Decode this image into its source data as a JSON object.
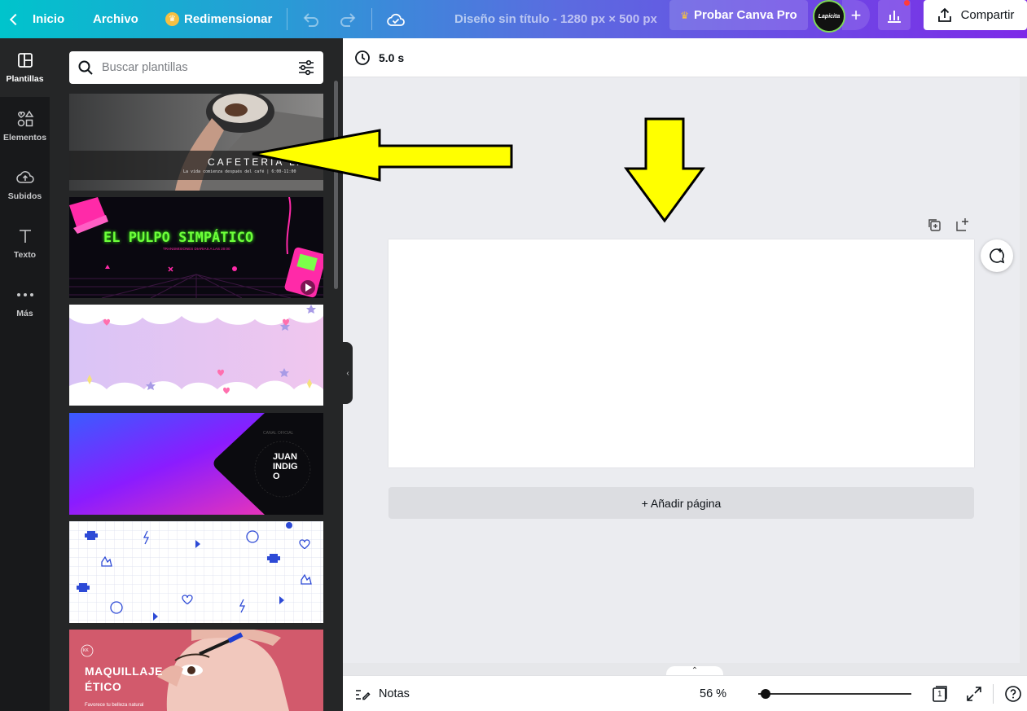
{
  "topbar": {
    "back_label": "Inicio",
    "file_label": "Archivo",
    "resize_label": "Redimensionar",
    "design_title": "Diseño sin título - 1280 px × 500 px",
    "pro_label": "Probar Canva Pro",
    "share_label": "Compartir",
    "avatar_text": "Lapicita"
  },
  "rail": {
    "items": [
      {
        "label": "Plantillas",
        "icon": "templates-icon"
      },
      {
        "label": "Elementos",
        "icon": "elements-icon"
      },
      {
        "label": "Subidos",
        "icon": "upload-cloud-icon"
      },
      {
        "label": "Texto",
        "icon": "text-icon"
      },
      {
        "label": "Más",
        "icon": "more-dots-icon"
      }
    ]
  },
  "panel": {
    "search_placeholder": "Buscar plantillas",
    "templates": [
      {
        "title": "CAFETERIA LA...",
        "subtitle": "La vida comienza después del café | 6:00-11:00"
      },
      {
        "title": "EL PULPO SIMPÁTICO",
        "subtitle": "TRANSMISIONES DIARIAS A LAS 20:00",
        "has_video": true
      },
      {
        "title": ""
      },
      {
        "title": "JUAN\nINDIG\nO",
        "ring_text": "CANAL OFICIAL"
      },
      {
        "title": ""
      },
      {
        "title": "MAQUILLAJE\nÉTICO",
        "subtitle": "Favorece tu belleza natural",
        "badge": "KK"
      }
    ]
  },
  "canvas": {
    "duration": "5.0 s",
    "add_page_label": "+ Añadir página"
  },
  "bottombar": {
    "notes_label": "Notas",
    "zoom_label": "56 %",
    "zoom_fraction": 0.05,
    "page_count": "1"
  },
  "colors": {
    "accent_start": "#00c4cc",
    "accent_end": "#7d2ae8",
    "annotation_arrow": "#ffff00"
  }
}
